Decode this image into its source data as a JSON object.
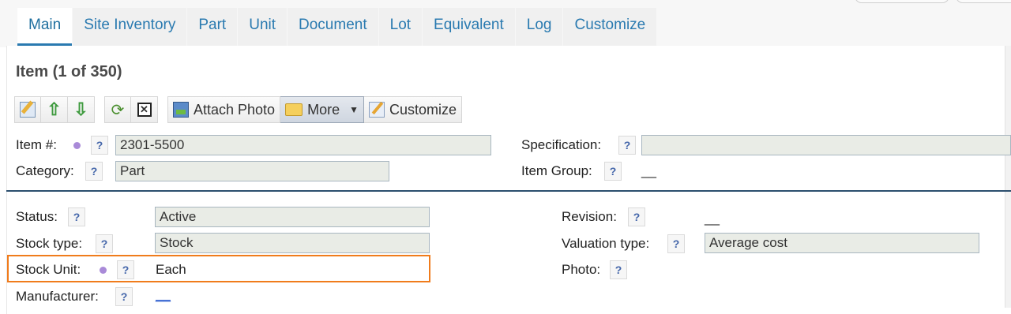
{
  "tabs": [
    {
      "label": "Main"
    },
    {
      "label": "Site Inventory"
    },
    {
      "label": "Part"
    },
    {
      "label": "Unit"
    },
    {
      "label": "Document"
    },
    {
      "label": "Lot"
    },
    {
      "label": "Equivalent"
    },
    {
      "label": "Log"
    },
    {
      "label": "Customize"
    }
  ],
  "page_title": "Item (1 of 350)",
  "toolbar": {
    "attach_photo_label": "Attach Photo",
    "more_label": "More",
    "customize_label": "Customize"
  },
  "help_glyph": "?",
  "header_fields": {
    "item_no": {
      "label": "Item #:",
      "value": "2301-5500"
    },
    "category": {
      "label": "Category:",
      "value": "Part"
    },
    "specification": {
      "label": "Specification:",
      "value": ""
    },
    "item_group": {
      "label": "Item Group:",
      "value": "__"
    }
  },
  "details": {
    "status": {
      "label": "Status:",
      "value": "Active"
    },
    "stock_type": {
      "label": "Stock type:",
      "value": "Stock"
    },
    "stock_unit": {
      "label": "Stock Unit:",
      "value": "Each"
    },
    "manufacturer": {
      "label": "Manufacturer:",
      "value": "__"
    },
    "revision": {
      "label": "Revision:",
      "value": "__"
    },
    "valuation_type": {
      "label": "Valuation type:",
      "value": "Average cost"
    },
    "photo": {
      "label": "Photo:"
    }
  },
  "colors": {
    "accent": "#2a7ab0",
    "highlight": "#f07c1c",
    "separator": "#2c4f6e",
    "required_dot": "#a98ad8"
  },
  "icons": [
    "edit-icon",
    "arrow-up-icon",
    "arrow-down-icon",
    "refresh-icon",
    "delete-icon",
    "photo-icon",
    "folder-icon",
    "chevron-down-icon",
    "customize-icon",
    "help-icon"
  ]
}
